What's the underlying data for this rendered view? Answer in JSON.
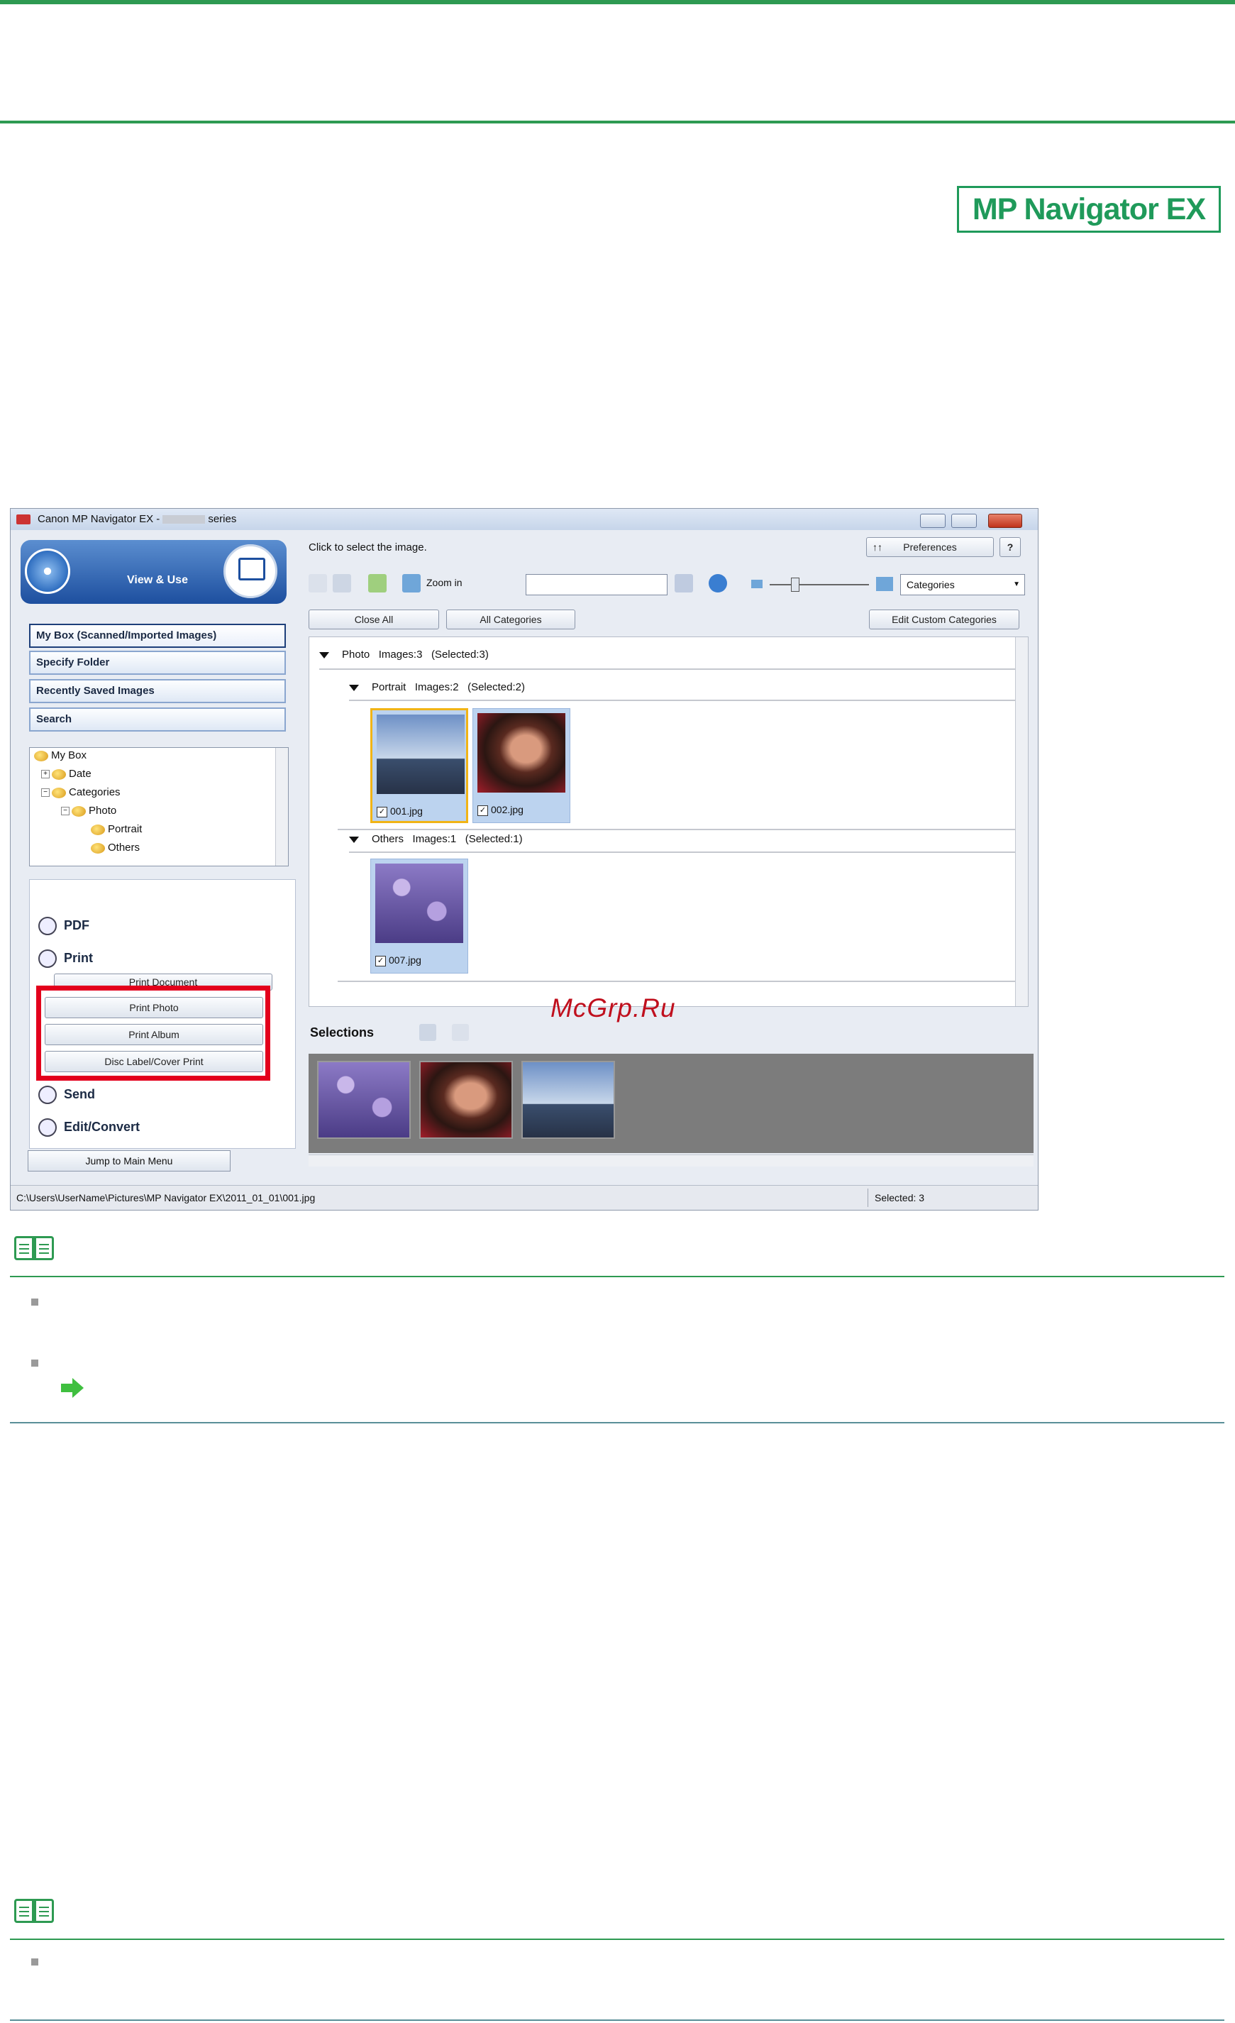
{
  "logo": {
    "text": "MP Navigator EX"
  },
  "window": {
    "title_prefix": "Canon MP Navigator EX -",
    "title_suffix": "series",
    "header_title": "View & Use",
    "nav_buttons": [
      "My Box (Scanned/Imported Images)",
      "Specify Folder",
      "Recently Saved Images",
      "Search"
    ],
    "tree": [
      {
        "label": "My Box",
        "level": 0
      },
      {
        "label": "Date",
        "level": 1
      },
      {
        "label": "Categories",
        "level": 1
      },
      {
        "label": "Photo",
        "level": 2
      },
      {
        "label": "Portrait",
        "level": 3
      },
      {
        "label": "Others",
        "level": 3
      }
    ],
    "collapse_glyph": "»",
    "sections": {
      "pdf": "PDF",
      "print": "Print",
      "send": "Send",
      "edit": "Edit/Convert"
    },
    "print_buttons": [
      "Print Document",
      "Print Photo",
      "Print Album",
      "Disc Label/Cover Print"
    ],
    "jump_button": "Jump to Main Menu",
    "status_path": "C:\\Users\\UserName\\Pictures\\MP Navigator EX\\2011_01_01\\001.jpg",
    "status_selected": "Selected: 3",
    "hint": "Click to select the image.",
    "preferences": "Preferences",
    "help": "?",
    "zoom_in": "Zoom in",
    "category_select": "Categories",
    "close_all": "Close All",
    "all_categories": "All Categories",
    "edit_custom": "Edit Custom Categories",
    "groups": {
      "photo": {
        "name": "Photo",
        "images": "Images:3",
        "selected": "(Selected:3)"
      },
      "portrait": {
        "name": "Portrait",
        "images": "Images:2",
        "selected": "(Selected:2)"
      },
      "others": {
        "name": "Others",
        "images": "Images:1",
        "selected": "(Selected:1)"
      }
    },
    "thumbs": [
      "001.jpg",
      "002.jpg",
      "007.jpg"
    ],
    "selections_label": "Selections"
  },
  "watermark": "McGrp.Ru",
  "colors": {
    "accent_green": "#2e9a52",
    "highlight_red": "#e3001c"
  }
}
